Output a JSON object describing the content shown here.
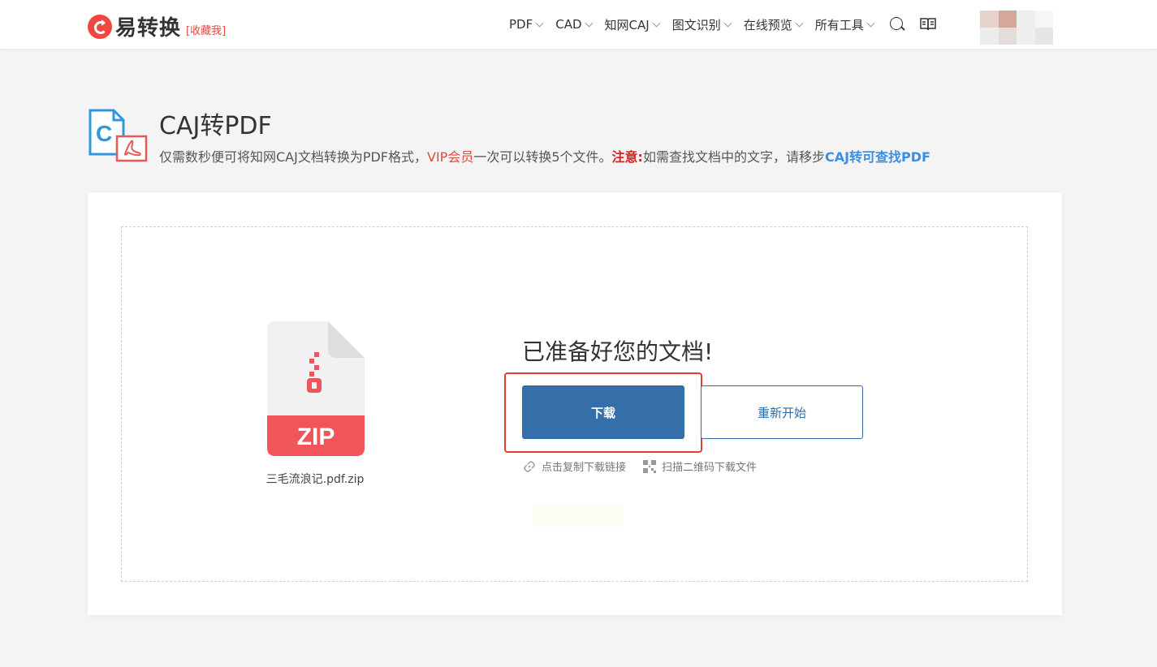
{
  "header": {
    "brand": "易转换",
    "favorite": "[收藏我]",
    "nav": [
      {
        "label": "PDF"
      },
      {
        "label": "CAD"
      },
      {
        "label": "知网CAJ"
      },
      {
        "label": "图文识别"
      },
      {
        "label": "在线预览"
      },
      {
        "label": "所有工具"
      }
    ]
  },
  "tool": {
    "title": "CAJ转PDF",
    "desc_part1": "仅需数秒便可将知网CAJ文档转换为PDF格式，",
    "desc_vip": "VIP会员",
    "desc_part2": "一次可以转换5个文件。",
    "desc_note": "注意:",
    "desc_part3": "如需查找文档中的文字，请移步",
    "desc_link": "CAJ转可查找PDF"
  },
  "result": {
    "file_badge": "ZIP",
    "file_name": "三毛流浪记.pdf.zip",
    "ready_title": "已准备好您的文档!",
    "download_label": "下载",
    "restart_label": "重新开始",
    "copy_link_label": "点击复制下载链接",
    "qr_label": "扫描二维码下载文件"
  },
  "colors": {
    "brand_red": "#f0473e",
    "primary_blue": "#356faa",
    "link_blue": "#3a8ee6",
    "highlight_red": "#e0412f"
  }
}
